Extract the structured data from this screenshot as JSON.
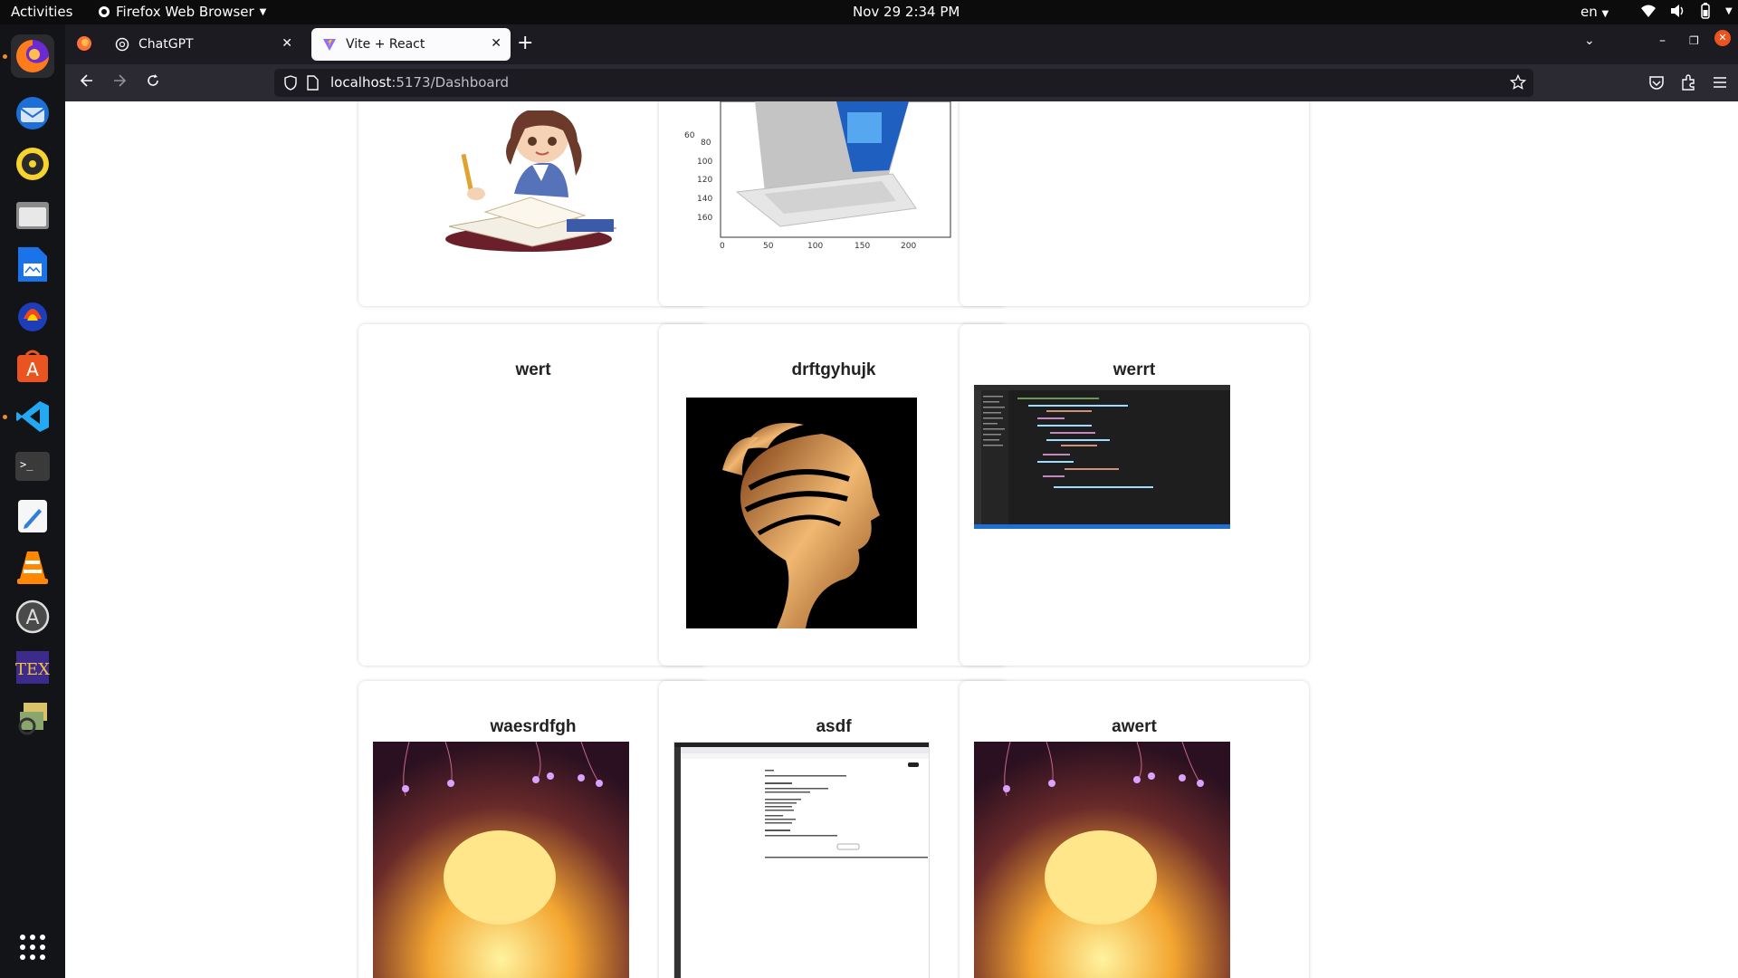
{
  "topbar": {
    "activities": "Activities",
    "app_name": "Firefox Web Browser",
    "clock": "Nov 29  2:34 PM",
    "lang": "en"
  },
  "dock": {
    "items": [
      "firefox-icon",
      "thunderbird-icon",
      "rhythmbox-icon",
      "files-icon",
      "writer-icon",
      "audacity-icon",
      "software-center-icon",
      "vscode-icon",
      "terminal-icon",
      "text-editor-icon",
      "vlc-icon",
      "updater-icon",
      "texmaker-icon",
      "archive-icon",
      "app-grid-icon"
    ]
  },
  "tabs": [
    {
      "title": "ChatGPT",
      "active": false
    },
    {
      "title": "Vite + React",
      "active": true
    }
  ],
  "url": {
    "host": "localhost",
    "path": ":5173/Dashboard"
  },
  "chart": {
    "y_ticks": [
      "60",
      "80",
      "100",
      "120",
      "140",
      "160"
    ],
    "x_ticks": [
      "0",
      "50",
      "100",
      "150",
      "200"
    ]
  },
  "cards": [
    {
      "title": "wert"
    },
    {
      "title": "drftgyhujk"
    },
    {
      "title": "werrt"
    },
    {
      "title": "waesrdfgh"
    },
    {
      "title": "asdf"
    },
    {
      "title": "awert"
    }
  ]
}
